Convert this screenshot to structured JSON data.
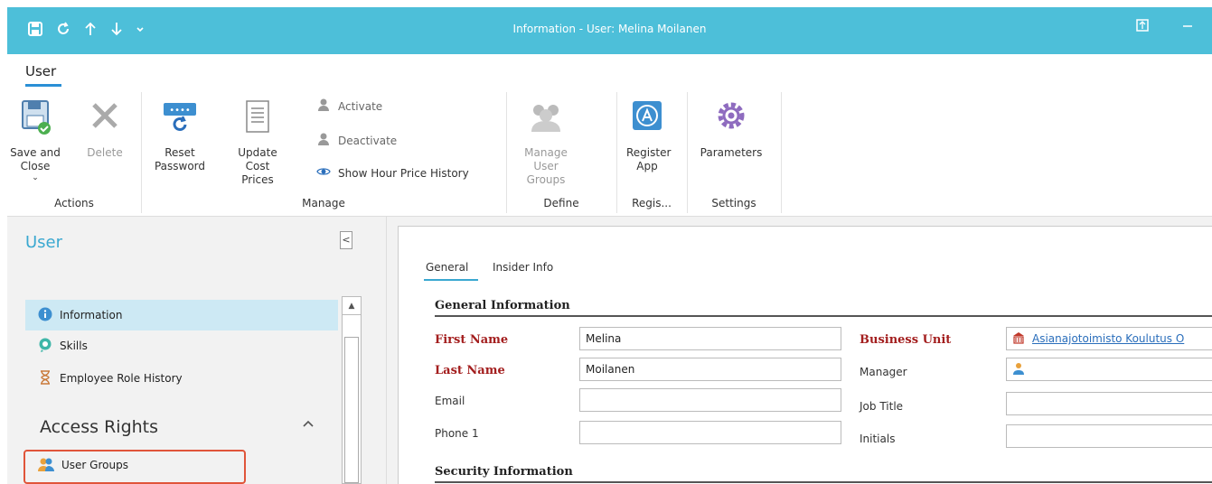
{
  "window": {
    "title": "Information - User: Melina Moilanen"
  },
  "ribbon": {
    "tab": "User",
    "buttons": {
      "save_close": "Save and Close",
      "delete": "Delete",
      "reset_password": "Reset Password",
      "update_cost_prices": "Update Cost Prices",
      "activate": "Activate",
      "deactivate": "Deactivate",
      "show_hour_price_history": "Show Hour Price History",
      "manage_user_groups": "Manage User Groups",
      "register_app": "Register App",
      "parameters": "Parameters"
    },
    "groups": {
      "actions": "Actions",
      "manage": "Manage",
      "define": "Define",
      "regis": "Regis...",
      "settings": "Settings"
    }
  },
  "nav": {
    "title": "User",
    "collapse": "<",
    "items": [
      {
        "label": "Information",
        "icon": "info-icon"
      },
      {
        "label": "Skills",
        "icon": "skills-icon"
      },
      {
        "label": "Employee Role History",
        "icon": "hourglass-icon"
      }
    ],
    "section": "Access Rights",
    "section_items": [
      {
        "label": "User Groups",
        "icon": "user-group-icon"
      }
    ]
  },
  "form": {
    "tabs": [
      "General",
      "Insider Info"
    ],
    "general_info_header": "General Information",
    "security_info_header": "Security Information",
    "fields": {
      "first_name": {
        "label": "First Name",
        "value": "Melina"
      },
      "last_name": {
        "label": "Last Name",
        "value": "Moilanen"
      },
      "email": {
        "label": "Email",
        "value": ""
      },
      "phone1": {
        "label": "Phone 1",
        "value": ""
      },
      "business_unit": {
        "label": "Business Unit",
        "value": "Asianajotoimisto Koulutus O"
      },
      "manager": {
        "label": "Manager",
        "value": ""
      },
      "job_title": {
        "label": "Job Title",
        "value": ""
      },
      "initials": {
        "label": "Initials",
        "value": ""
      }
    }
  },
  "colors": {
    "titlebar": "#4dbfd9",
    "accent": "#3aa8d0",
    "required": "#a31e1e",
    "highlight": "#e0553a"
  }
}
